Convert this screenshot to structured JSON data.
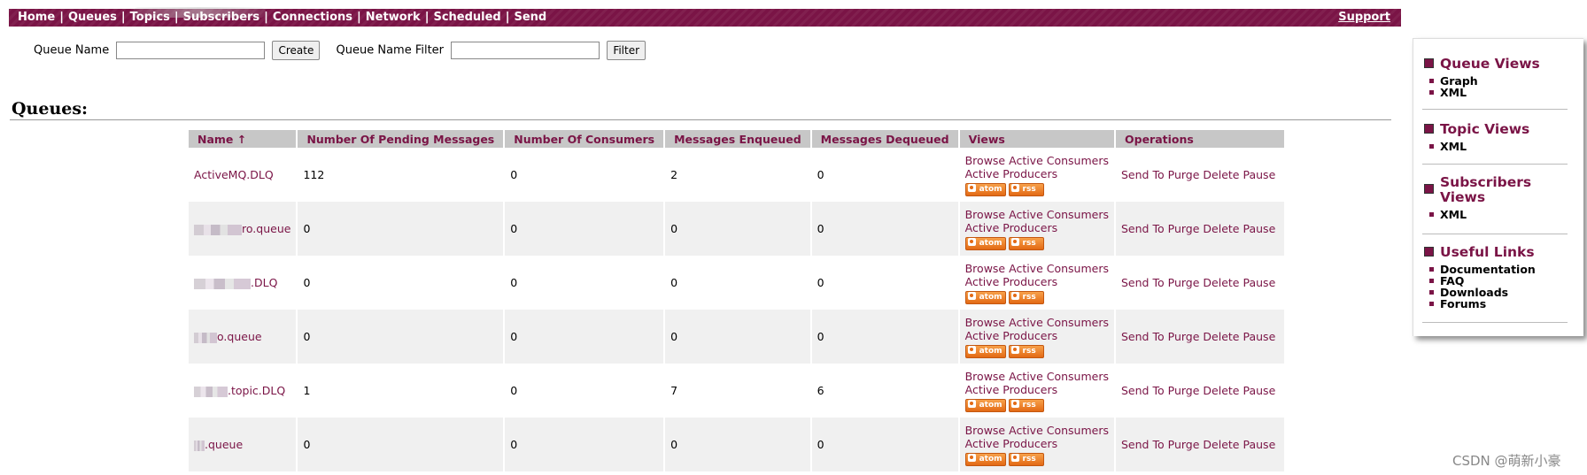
{
  "nav": {
    "items": [
      "Home",
      "Queues",
      "Topics",
      "Subscribers",
      "Connections",
      "Network",
      "Scheduled",
      "Send"
    ],
    "support": "Support"
  },
  "form": {
    "queue_name_label": "Queue Name",
    "queue_name_value": "",
    "create_label": "Create",
    "filter_label": "Queue Name Filter",
    "filter_value": "",
    "filter_button": "Filter"
  },
  "heading": "Queues:",
  "table": {
    "headers": [
      "Name ↑",
      "Number Of Pending Messages",
      "Number Of Consumers",
      "Messages Enqueued",
      "Messages Dequeued",
      "Views",
      "Operations"
    ],
    "views": {
      "browse": "Browse",
      "consumers": "Active Consumers",
      "producers": "Active Producers",
      "atom": "atom",
      "rss": "rss"
    },
    "ops": [
      "Send To",
      "Purge",
      "Delete",
      "Pause"
    ],
    "rows": [
      {
        "name": "ActiveMQ.DLQ",
        "pending": "112",
        "consumers": "0",
        "enqueued": "2",
        "dequeued": "0"
      },
      {
        "name": "ro.queue",
        "pending": "0",
        "consumers": "0",
        "enqueued": "0",
        "dequeued": "0"
      },
      {
        "name": ".DLQ",
        "pending": "0",
        "consumers": "0",
        "enqueued": "0",
        "dequeued": "0"
      },
      {
        "name": "o.queue",
        "pending": "0",
        "consumers": "0",
        "enqueued": "0",
        "dequeued": "0"
      },
      {
        "name": ".topic.DLQ",
        "pending": "1",
        "consumers": "0",
        "enqueued": "7",
        "dequeued": "6"
      },
      {
        "name": ".queue",
        "pending": "0",
        "consumers": "0",
        "enqueued": "0",
        "dequeued": "0"
      }
    ]
  },
  "sidebar": {
    "sections": [
      {
        "title": "Queue Views",
        "items": [
          "Graph",
          "XML"
        ]
      },
      {
        "title": "Topic Views",
        "items": [
          "XML"
        ]
      },
      {
        "title": "Subscribers Views",
        "items": [
          "XML"
        ]
      },
      {
        "title": "Useful Links",
        "items": [
          "Documentation",
          "FAQ",
          "Downloads",
          "Forums"
        ]
      }
    ]
  },
  "watermark": "CSDN @萌新小豪",
  "colors": {
    "brand": "#7a1446",
    "header_bg": "#c7c7c7",
    "badge": "#e36a15"
  }
}
